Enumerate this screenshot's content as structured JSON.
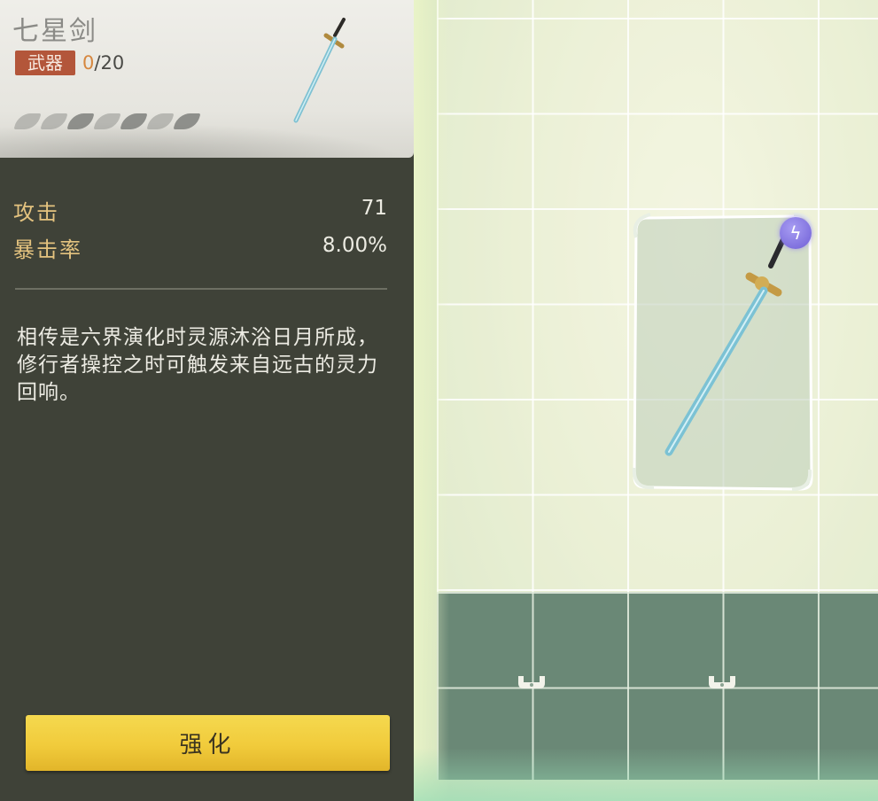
{
  "item": {
    "name": "七星剑",
    "type": "武器",
    "level_current": "0",
    "level_sep": "/",
    "level_max": "20",
    "refine_pips_total": 7,
    "refine_pips_lit": 0
  },
  "stats": [
    {
      "label": "攻击",
      "value": "71"
    },
    {
      "label": "暴击率",
      "value": "8.00%"
    }
  ],
  "description": "相传是六界演化时灵源沐浴日月所成，修行者操控之时可触发来自远古的灵力回响。",
  "actions": {
    "enhance_label": "强化"
  },
  "icons": {
    "element": "lightning-element-icon",
    "socket": "socket-lock-icon"
  },
  "colors": {
    "panel_bg": "#3f4238",
    "stat_label": "#e4c37f",
    "badge_bg": "#b3563a",
    "level_current": "#d6873f",
    "button_bg": "#f1cb3b",
    "element_icon": "#7f70e0"
  }
}
